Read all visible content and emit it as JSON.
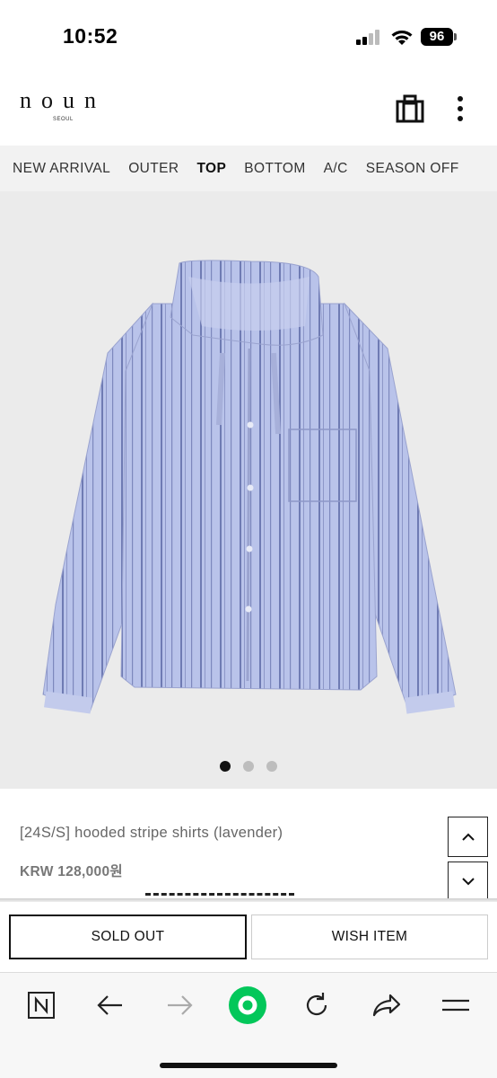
{
  "status_bar": {
    "time": "10:52",
    "battery": "96",
    "icons": [
      "signal-icon",
      "wifi-icon",
      "battery-icon"
    ]
  },
  "header": {
    "logo": "noun",
    "logo_sub": "SEOUL",
    "icons": [
      "shopping-bag-icon",
      "more-vertical-icon"
    ]
  },
  "category_nav": {
    "items": [
      {
        "label": "NEW ARRIVAL",
        "active": false
      },
      {
        "label": "OUTER",
        "active": false
      },
      {
        "label": "TOP",
        "active": true
      },
      {
        "label": "BOTTOM",
        "active": false
      },
      {
        "label": "A/C",
        "active": false
      },
      {
        "label": "SEASON OFF",
        "active": false
      }
    ]
  },
  "gallery": {
    "image_alt": "hooded stripe shirt",
    "slide_count": 3,
    "active_slide": 1,
    "colors": {
      "background": "#ebebeb",
      "shirt": "#b9c3ea",
      "stripe": "#6f7bb3"
    }
  },
  "product": {
    "name": "[24S/S] hooded stripe shirts (lavender)",
    "price": "KRW 128,000원",
    "scroll_up_icon": "chevron-up-icon",
    "scroll_down_icon": "chevron-down-icon"
  },
  "actions": {
    "sold_out_label": "SOLD OUT",
    "wish_label": "WISH ITEM"
  },
  "browser_toolbar": {
    "items": [
      "naver-n-icon",
      "back-arrow-icon",
      "forward-arrow-icon",
      "green-dot-icon",
      "refresh-icon",
      "share-icon",
      "menu-icon"
    ],
    "accent": "#03c75a"
  }
}
